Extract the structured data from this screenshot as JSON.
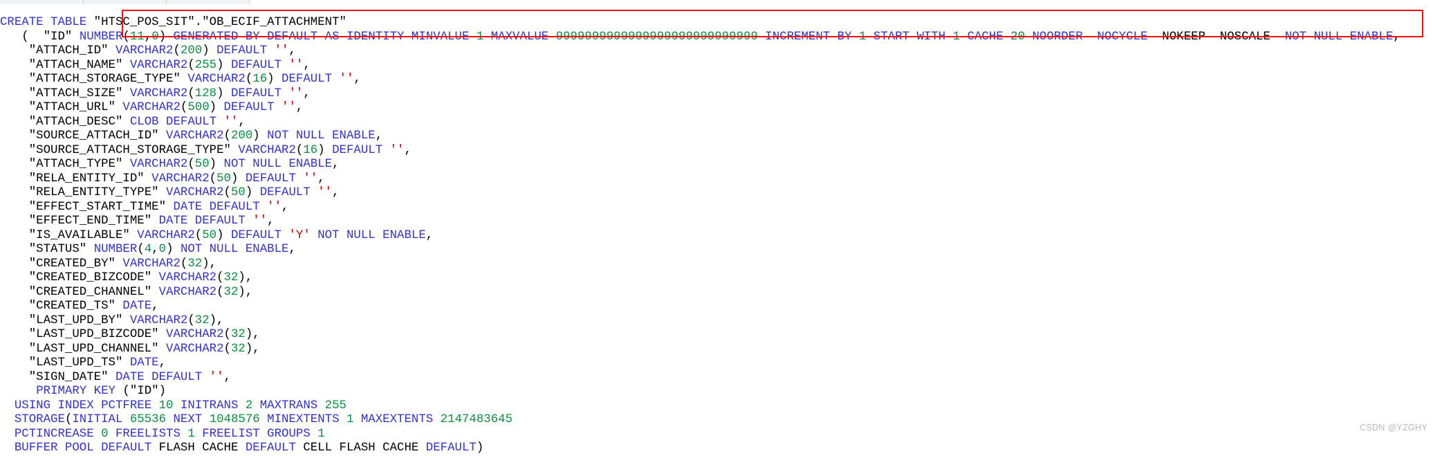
{
  "window": {
    "title": "OB_ECIF_ATTACHMENT DDL",
    "background_color": "#ffffff"
  },
  "theme": {
    "keyword_color": "#3333cc",
    "number_color": "#0a8f3c",
    "string_color": "#cc0000",
    "identifier_color": "#000000",
    "annotation_color": "#ee1111",
    "watermark_color": "#b9b9b9"
  },
  "annotation": {
    "type": "rectangle-highlight",
    "color": "#ee1111",
    "label": "red-rectangle-annotation"
  },
  "watermark": {
    "text": "CSDN @YZGHY"
  },
  "code": {
    "language": "sql",
    "statement_type": "CREATE TABLE",
    "schema": "HTSC_POS_SIT",
    "table": "OB_ECIF_ATTACHMENT",
    "lines": [
      [
        {
          "t": "CREATE TABLE ",
          "c": "kw"
        },
        {
          "t": "\"HTSC_POS_SIT\".\"OB_ECIF_ATTACHMENT\"",
          "c": "id"
        }
      ],
      [
        {
          "t": "   (  ",
          "c": "pl"
        },
        {
          "t": "\"ID\"",
          "c": "id"
        },
        {
          "t": " ",
          "c": "pl"
        },
        {
          "t": "NUMBER",
          "c": "kw"
        },
        {
          "t": "(",
          "c": "pl"
        },
        {
          "t": "11",
          "c": "num"
        },
        {
          "t": ",",
          "c": "pl"
        },
        {
          "t": "0",
          "c": "num"
        },
        {
          "t": ") ",
          "c": "pl"
        },
        {
          "t": "GENERATED BY DEFAULT AS IDENTITY MINVALUE ",
          "c": "kw"
        },
        {
          "t": "1",
          "c": "num"
        },
        {
          "t": " MAXVALUE ",
          "c": "kw"
        },
        {
          "t": "9999999999999999999999999999",
          "c": "num"
        },
        {
          "t": " INCREMENT BY ",
          "c": "kw"
        },
        {
          "t": "1",
          "c": "num"
        },
        {
          "t": " START WITH ",
          "c": "kw"
        },
        {
          "t": "1",
          "c": "num"
        },
        {
          "t": " CACHE ",
          "c": "kw"
        },
        {
          "t": "20",
          "c": "num"
        },
        {
          "t": " NOORDER  NOCYCLE ",
          "c": "kw"
        },
        {
          "t": " NOKEEP  NOSCALE ",
          "c": "pl"
        },
        {
          "t": " NOT NULL ENABLE",
          "c": "kw"
        },
        {
          "t": ",",
          "c": "pl"
        }
      ],
      [
        {
          "t": "\t",
          "c": "pl"
        },
        {
          "t": "\"ATTACH_ID\"",
          "c": "id"
        },
        {
          "t": " ",
          "c": "pl"
        },
        {
          "t": "VARCHAR2",
          "c": "kw"
        },
        {
          "t": "(",
          "c": "pl"
        },
        {
          "t": "200",
          "c": "num"
        },
        {
          "t": ") ",
          "c": "pl"
        },
        {
          "t": "DEFAULT ",
          "c": "kw"
        },
        {
          "t": "''",
          "c": "str"
        },
        {
          "t": ",",
          "c": "pl"
        }
      ],
      [
        {
          "t": "\t",
          "c": "pl"
        },
        {
          "t": "\"ATTACH_NAME\"",
          "c": "id"
        },
        {
          "t": " ",
          "c": "pl"
        },
        {
          "t": "VARCHAR2",
          "c": "kw"
        },
        {
          "t": "(",
          "c": "pl"
        },
        {
          "t": "255",
          "c": "num"
        },
        {
          "t": ") ",
          "c": "pl"
        },
        {
          "t": "DEFAULT ",
          "c": "kw"
        },
        {
          "t": "''",
          "c": "str"
        },
        {
          "t": ",",
          "c": "pl"
        }
      ],
      [
        {
          "t": "\t",
          "c": "pl"
        },
        {
          "t": "\"ATTACH_STORAGE_TYPE\"",
          "c": "id"
        },
        {
          "t": " ",
          "c": "pl"
        },
        {
          "t": "VARCHAR2",
          "c": "kw"
        },
        {
          "t": "(",
          "c": "pl"
        },
        {
          "t": "16",
          "c": "num"
        },
        {
          "t": ") ",
          "c": "pl"
        },
        {
          "t": "DEFAULT ",
          "c": "kw"
        },
        {
          "t": "''",
          "c": "str"
        },
        {
          "t": ",",
          "c": "pl"
        }
      ],
      [
        {
          "t": "\t",
          "c": "pl"
        },
        {
          "t": "\"ATTACH_SIZE\"",
          "c": "id"
        },
        {
          "t": " ",
          "c": "pl"
        },
        {
          "t": "VARCHAR2",
          "c": "kw"
        },
        {
          "t": "(",
          "c": "pl"
        },
        {
          "t": "128",
          "c": "num"
        },
        {
          "t": ") ",
          "c": "pl"
        },
        {
          "t": "DEFAULT ",
          "c": "kw"
        },
        {
          "t": "''",
          "c": "str"
        },
        {
          "t": ",",
          "c": "pl"
        }
      ],
      [
        {
          "t": "\t",
          "c": "pl"
        },
        {
          "t": "\"ATTACH_URL\"",
          "c": "id"
        },
        {
          "t": " ",
          "c": "pl"
        },
        {
          "t": "VARCHAR2",
          "c": "kw"
        },
        {
          "t": "(",
          "c": "pl"
        },
        {
          "t": "500",
          "c": "num"
        },
        {
          "t": ") ",
          "c": "pl"
        },
        {
          "t": "DEFAULT ",
          "c": "kw"
        },
        {
          "t": "''",
          "c": "str"
        },
        {
          "t": ",",
          "c": "pl"
        }
      ],
      [
        {
          "t": "\t",
          "c": "pl"
        },
        {
          "t": "\"ATTACH_DESC\"",
          "c": "id"
        },
        {
          "t": " ",
          "c": "pl"
        },
        {
          "t": "CLOB DEFAULT ",
          "c": "kw"
        },
        {
          "t": "''",
          "c": "str"
        },
        {
          "t": ",",
          "c": "pl"
        }
      ],
      [
        {
          "t": "\t",
          "c": "pl"
        },
        {
          "t": "\"SOURCE_ATTACH_ID\"",
          "c": "id"
        },
        {
          "t": " ",
          "c": "pl"
        },
        {
          "t": "VARCHAR2",
          "c": "kw"
        },
        {
          "t": "(",
          "c": "pl"
        },
        {
          "t": "200",
          "c": "num"
        },
        {
          "t": ") ",
          "c": "pl"
        },
        {
          "t": "NOT NULL ENABLE",
          "c": "kw"
        },
        {
          "t": ",",
          "c": "pl"
        }
      ],
      [
        {
          "t": "\t",
          "c": "pl"
        },
        {
          "t": "\"SOURCE_ATTACH_STORAGE_TYPE\"",
          "c": "id"
        },
        {
          "t": " ",
          "c": "pl"
        },
        {
          "t": "VARCHAR2",
          "c": "kw"
        },
        {
          "t": "(",
          "c": "pl"
        },
        {
          "t": "16",
          "c": "num"
        },
        {
          "t": ") ",
          "c": "pl"
        },
        {
          "t": "DEFAULT ",
          "c": "kw"
        },
        {
          "t": "''",
          "c": "str"
        },
        {
          "t": ",",
          "c": "pl"
        }
      ],
      [
        {
          "t": "\t",
          "c": "pl"
        },
        {
          "t": "\"ATTACH_TYPE\"",
          "c": "id"
        },
        {
          "t": " ",
          "c": "pl"
        },
        {
          "t": "VARCHAR2",
          "c": "kw"
        },
        {
          "t": "(",
          "c": "pl"
        },
        {
          "t": "50",
          "c": "num"
        },
        {
          "t": ") ",
          "c": "pl"
        },
        {
          "t": "NOT NULL ENABLE",
          "c": "kw"
        },
        {
          "t": ",",
          "c": "pl"
        }
      ],
      [
        {
          "t": "\t",
          "c": "pl"
        },
        {
          "t": "\"RELA_ENTITY_ID\"",
          "c": "id"
        },
        {
          "t": " ",
          "c": "pl"
        },
        {
          "t": "VARCHAR2",
          "c": "kw"
        },
        {
          "t": "(",
          "c": "pl"
        },
        {
          "t": "50",
          "c": "num"
        },
        {
          "t": ") ",
          "c": "pl"
        },
        {
          "t": "DEFAULT ",
          "c": "kw"
        },
        {
          "t": "''",
          "c": "str"
        },
        {
          "t": ",",
          "c": "pl"
        }
      ],
      [
        {
          "t": "\t",
          "c": "pl"
        },
        {
          "t": "\"RELA_ENTITY_TYPE\"",
          "c": "id"
        },
        {
          "t": " ",
          "c": "pl"
        },
        {
          "t": "VARCHAR2",
          "c": "kw"
        },
        {
          "t": "(",
          "c": "pl"
        },
        {
          "t": "50",
          "c": "num"
        },
        {
          "t": ") ",
          "c": "pl"
        },
        {
          "t": "DEFAULT ",
          "c": "kw"
        },
        {
          "t": "''",
          "c": "str"
        },
        {
          "t": ",",
          "c": "pl"
        }
      ],
      [
        {
          "t": "\t",
          "c": "pl"
        },
        {
          "t": "\"EFFECT_START_TIME\"",
          "c": "id"
        },
        {
          "t": " ",
          "c": "pl"
        },
        {
          "t": "DATE DEFAULT ",
          "c": "kw"
        },
        {
          "t": "''",
          "c": "str"
        },
        {
          "t": ",",
          "c": "pl"
        }
      ],
      [
        {
          "t": "\t",
          "c": "pl"
        },
        {
          "t": "\"EFFECT_END_TIME\"",
          "c": "id"
        },
        {
          "t": " ",
          "c": "pl"
        },
        {
          "t": "DATE DEFAULT ",
          "c": "kw"
        },
        {
          "t": "''",
          "c": "str"
        },
        {
          "t": ",",
          "c": "pl"
        }
      ],
      [
        {
          "t": "\t",
          "c": "pl"
        },
        {
          "t": "\"IS_AVAILABLE\"",
          "c": "id"
        },
        {
          "t": " ",
          "c": "pl"
        },
        {
          "t": "VARCHAR2",
          "c": "kw"
        },
        {
          "t": "(",
          "c": "pl"
        },
        {
          "t": "50",
          "c": "num"
        },
        {
          "t": ") ",
          "c": "pl"
        },
        {
          "t": "DEFAULT ",
          "c": "kw"
        },
        {
          "t": "'Y'",
          "c": "str"
        },
        {
          "t": " ",
          "c": "pl"
        },
        {
          "t": "NOT NULL ENABLE",
          "c": "kw"
        },
        {
          "t": ",",
          "c": "pl"
        }
      ],
      [
        {
          "t": "\t",
          "c": "pl"
        },
        {
          "t": "\"STATUS\"",
          "c": "id"
        },
        {
          "t": " ",
          "c": "pl"
        },
        {
          "t": "NUMBER",
          "c": "kw"
        },
        {
          "t": "(",
          "c": "pl"
        },
        {
          "t": "4",
          "c": "num"
        },
        {
          "t": ",",
          "c": "pl"
        },
        {
          "t": "0",
          "c": "num"
        },
        {
          "t": ") ",
          "c": "pl"
        },
        {
          "t": "NOT NULL ENABLE",
          "c": "kw"
        },
        {
          "t": ",",
          "c": "pl"
        }
      ],
      [
        {
          "t": "\t",
          "c": "pl"
        },
        {
          "t": "\"CREATED_BY\"",
          "c": "id"
        },
        {
          "t": " ",
          "c": "pl"
        },
        {
          "t": "VARCHAR2",
          "c": "kw"
        },
        {
          "t": "(",
          "c": "pl"
        },
        {
          "t": "32",
          "c": "num"
        },
        {
          "t": "),",
          "c": "pl"
        }
      ],
      [
        {
          "t": "\t",
          "c": "pl"
        },
        {
          "t": "\"CREATED_BIZCODE\"",
          "c": "id"
        },
        {
          "t": " ",
          "c": "pl"
        },
        {
          "t": "VARCHAR2",
          "c": "kw"
        },
        {
          "t": "(",
          "c": "pl"
        },
        {
          "t": "32",
          "c": "num"
        },
        {
          "t": "),",
          "c": "pl"
        }
      ],
      [
        {
          "t": "\t",
          "c": "pl"
        },
        {
          "t": "\"CREATED_CHANNEL\"",
          "c": "id"
        },
        {
          "t": " ",
          "c": "pl"
        },
        {
          "t": "VARCHAR2",
          "c": "kw"
        },
        {
          "t": "(",
          "c": "pl"
        },
        {
          "t": "32",
          "c": "num"
        },
        {
          "t": "),",
          "c": "pl"
        }
      ],
      [
        {
          "t": "\t",
          "c": "pl"
        },
        {
          "t": "\"CREATED_TS\"",
          "c": "id"
        },
        {
          "t": " ",
          "c": "pl"
        },
        {
          "t": "DATE",
          "c": "kw"
        },
        {
          "t": ",",
          "c": "pl"
        }
      ],
      [
        {
          "t": "\t",
          "c": "pl"
        },
        {
          "t": "\"LAST_UPD_BY\"",
          "c": "id"
        },
        {
          "t": " ",
          "c": "pl"
        },
        {
          "t": "VARCHAR2",
          "c": "kw"
        },
        {
          "t": "(",
          "c": "pl"
        },
        {
          "t": "32",
          "c": "num"
        },
        {
          "t": "),",
          "c": "pl"
        }
      ],
      [
        {
          "t": "\t",
          "c": "pl"
        },
        {
          "t": "\"LAST_UPD_BIZCODE\"",
          "c": "id"
        },
        {
          "t": " ",
          "c": "pl"
        },
        {
          "t": "VARCHAR2",
          "c": "kw"
        },
        {
          "t": "(",
          "c": "pl"
        },
        {
          "t": "32",
          "c": "num"
        },
        {
          "t": "),",
          "c": "pl"
        }
      ],
      [
        {
          "t": "\t",
          "c": "pl"
        },
        {
          "t": "\"LAST_UPD_CHANNEL\"",
          "c": "id"
        },
        {
          "t": " ",
          "c": "pl"
        },
        {
          "t": "VARCHAR2",
          "c": "kw"
        },
        {
          "t": "(",
          "c": "pl"
        },
        {
          "t": "32",
          "c": "num"
        },
        {
          "t": "),",
          "c": "pl"
        }
      ],
      [
        {
          "t": "\t",
          "c": "pl"
        },
        {
          "t": "\"LAST_UPD_TS\"",
          "c": "id"
        },
        {
          "t": " ",
          "c": "pl"
        },
        {
          "t": "DATE",
          "c": "kw"
        },
        {
          "t": ",",
          "c": "pl"
        }
      ],
      [
        {
          "t": "\t",
          "c": "pl"
        },
        {
          "t": "\"SIGN_DATE\"",
          "c": "id"
        },
        {
          "t": " ",
          "c": "pl"
        },
        {
          "t": "DATE DEFAULT ",
          "c": "kw"
        },
        {
          "t": "''",
          "c": "str"
        },
        {
          "t": ",",
          "c": "pl"
        }
      ],
      [
        {
          "t": "\t ",
          "c": "pl"
        },
        {
          "t": "PRIMARY KEY ",
          "c": "kw"
        },
        {
          "t": "(",
          "c": "pl"
        },
        {
          "t": "\"ID\"",
          "c": "id"
        },
        {
          "t": ")",
          "c": "pl"
        }
      ],
      [
        {
          "t": "  ",
          "c": "pl"
        },
        {
          "t": "USING INDEX PCTFREE ",
          "c": "kw"
        },
        {
          "t": "10",
          "c": "num"
        },
        {
          "t": " INITRANS ",
          "c": "kw"
        },
        {
          "t": "2",
          "c": "num"
        },
        {
          "t": " MAXTRANS ",
          "c": "kw"
        },
        {
          "t": "255",
          "c": "num"
        }
      ],
      [
        {
          "t": "  ",
          "c": "pl"
        },
        {
          "t": "STORAGE",
          "c": "kw"
        },
        {
          "t": "(",
          "c": "pl"
        },
        {
          "t": "INITIAL ",
          "c": "kw"
        },
        {
          "t": "65536",
          "c": "num"
        },
        {
          "t": " NEXT ",
          "c": "kw"
        },
        {
          "t": "1048576",
          "c": "num"
        },
        {
          "t": " MINEXTENTS ",
          "c": "kw"
        },
        {
          "t": "1",
          "c": "num"
        },
        {
          "t": " MAXEXTENTS ",
          "c": "kw"
        },
        {
          "t": "2147483645",
          "c": "num"
        }
      ],
      [
        {
          "t": "  ",
          "c": "pl"
        },
        {
          "t": "PCTINCREASE ",
          "c": "kw"
        },
        {
          "t": "0",
          "c": "num"
        },
        {
          "t": " FREELISTS ",
          "c": "kw"
        },
        {
          "t": "1",
          "c": "num"
        },
        {
          "t": " FREELIST GROUPS ",
          "c": "kw"
        },
        {
          "t": "1",
          "c": "num"
        }
      ],
      [
        {
          "t": "  ",
          "c": "pl"
        },
        {
          "t": "BUFFER POOL DEFAULT ",
          "c": "kw"
        },
        {
          "t": "FLASH CACHE ",
          "c": "pl"
        },
        {
          "t": "DEFAULT ",
          "c": "kw"
        },
        {
          "t": "CELL FLASH CACHE ",
          "c": "pl"
        },
        {
          "t": "DEFAULT",
          "c": "kw"
        },
        {
          "t": ")",
          "c": "pl"
        }
      ]
    ]
  }
}
